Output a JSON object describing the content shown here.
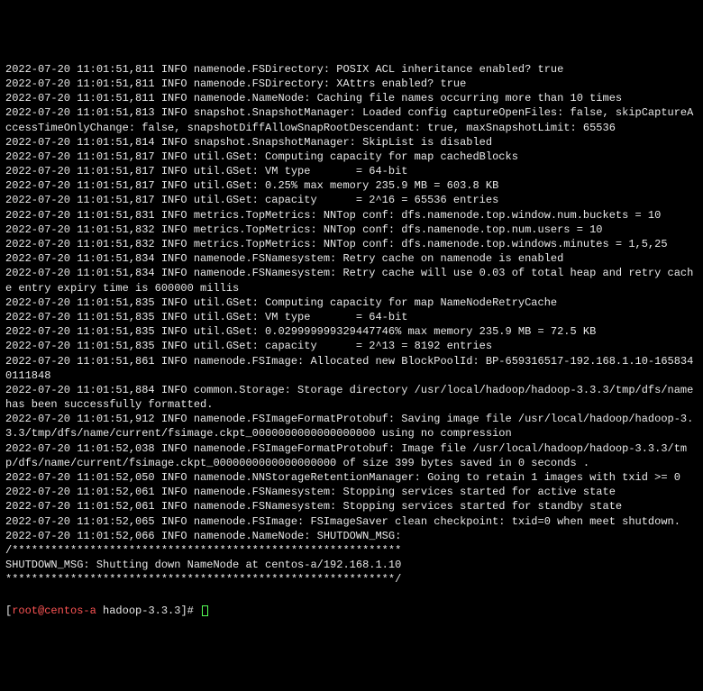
{
  "logs": [
    "2022-07-20 11:01:51,811 INFO namenode.FSDirectory: POSIX ACL inheritance enabled? true",
    "2022-07-20 11:01:51,811 INFO namenode.FSDirectory: XAttrs enabled? true",
    "2022-07-20 11:01:51,811 INFO namenode.NameNode: Caching file names occurring more than 10 times",
    "2022-07-20 11:01:51,813 INFO snapshot.SnapshotManager: Loaded config captureOpenFiles: false, skipCaptureAccessTimeOnlyChange: false, snapshotDiffAllowSnapRootDescendant: true, maxSnapshotLimit: 65536",
    "2022-07-20 11:01:51,814 INFO snapshot.SnapshotManager: SkipList is disabled",
    "2022-07-20 11:01:51,817 INFO util.GSet: Computing capacity for map cachedBlocks",
    "2022-07-20 11:01:51,817 INFO util.GSet: VM type       = 64-bit",
    "2022-07-20 11:01:51,817 INFO util.GSet: 0.25% max memory 235.9 MB = 603.8 KB",
    "2022-07-20 11:01:51,817 INFO util.GSet: capacity      = 2^16 = 65536 entries",
    "2022-07-20 11:01:51,831 INFO metrics.TopMetrics: NNTop conf: dfs.namenode.top.window.num.buckets = 10",
    "2022-07-20 11:01:51,832 INFO metrics.TopMetrics: NNTop conf: dfs.namenode.top.num.users = 10",
    "2022-07-20 11:01:51,832 INFO metrics.TopMetrics: NNTop conf: dfs.namenode.top.windows.minutes = 1,5,25",
    "2022-07-20 11:01:51,834 INFO namenode.FSNamesystem: Retry cache on namenode is enabled",
    "2022-07-20 11:01:51,834 INFO namenode.FSNamesystem: Retry cache will use 0.03 of total heap and retry cache entry expiry time is 600000 millis",
    "2022-07-20 11:01:51,835 INFO util.GSet: Computing capacity for map NameNodeRetryCache",
    "2022-07-20 11:01:51,835 INFO util.GSet: VM type       = 64-bit",
    "2022-07-20 11:01:51,835 INFO util.GSet: 0.029999999329447746% max memory 235.9 MB = 72.5 KB",
    "2022-07-20 11:01:51,835 INFO util.GSet: capacity      = 2^13 = 8192 entries",
    "2022-07-20 11:01:51,861 INFO namenode.FSImage: Allocated new BlockPoolId: BP-659316517-192.168.1.10-1658340111848",
    "2022-07-20 11:01:51,884 INFO common.Storage: Storage directory /usr/local/hadoop/hadoop-3.3.3/tmp/dfs/name has been successfully formatted.",
    "2022-07-20 11:01:51,912 INFO namenode.FSImageFormatProtobuf: Saving image file /usr/local/hadoop/hadoop-3.3.3/tmp/dfs/name/current/fsimage.ckpt_0000000000000000000 using no compression",
    "2022-07-20 11:01:52,038 INFO namenode.FSImageFormatProtobuf: Image file /usr/local/hadoop/hadoop-3.3.3/tmp/dfs/name/current/fsimage.ckpt_0000000000000000000 of size 399 bytes saved in 0 seconds .",
    "2022-07-20 11:01:52,050 INFO namenode.NNStorageRetentionManager: Going to retain 1 images with txid >= 0",
    "2022-07-20 11:01:52,061 INFO namenode.FSNamesystem: Stopping services started for active state",
    "2022-07-20 11:01:52,061 INFO namenode.FSNamesystem: Stopping services started for standby state",
    "2022-07-20 11:01:52,065 INFO namenode.FSImage: FSImageSaver clean checkpoint: txid=0 when meet shutdown.",
    "2022-07-20 11:01:52,066 INFO namenode.NameNode: SHUTDOWN_MSG:",
    "/************************************************************",
    "SHUTDOWN_MSG: Shutting down NameNode at centos-a/192.168.1.10",
    "************************************************************/"
  ],
  "prompt": {
    "user_host": "root@centos-a",
    "path": "hadoop-3.3.3",
    "symbol": "#"
  }
}
